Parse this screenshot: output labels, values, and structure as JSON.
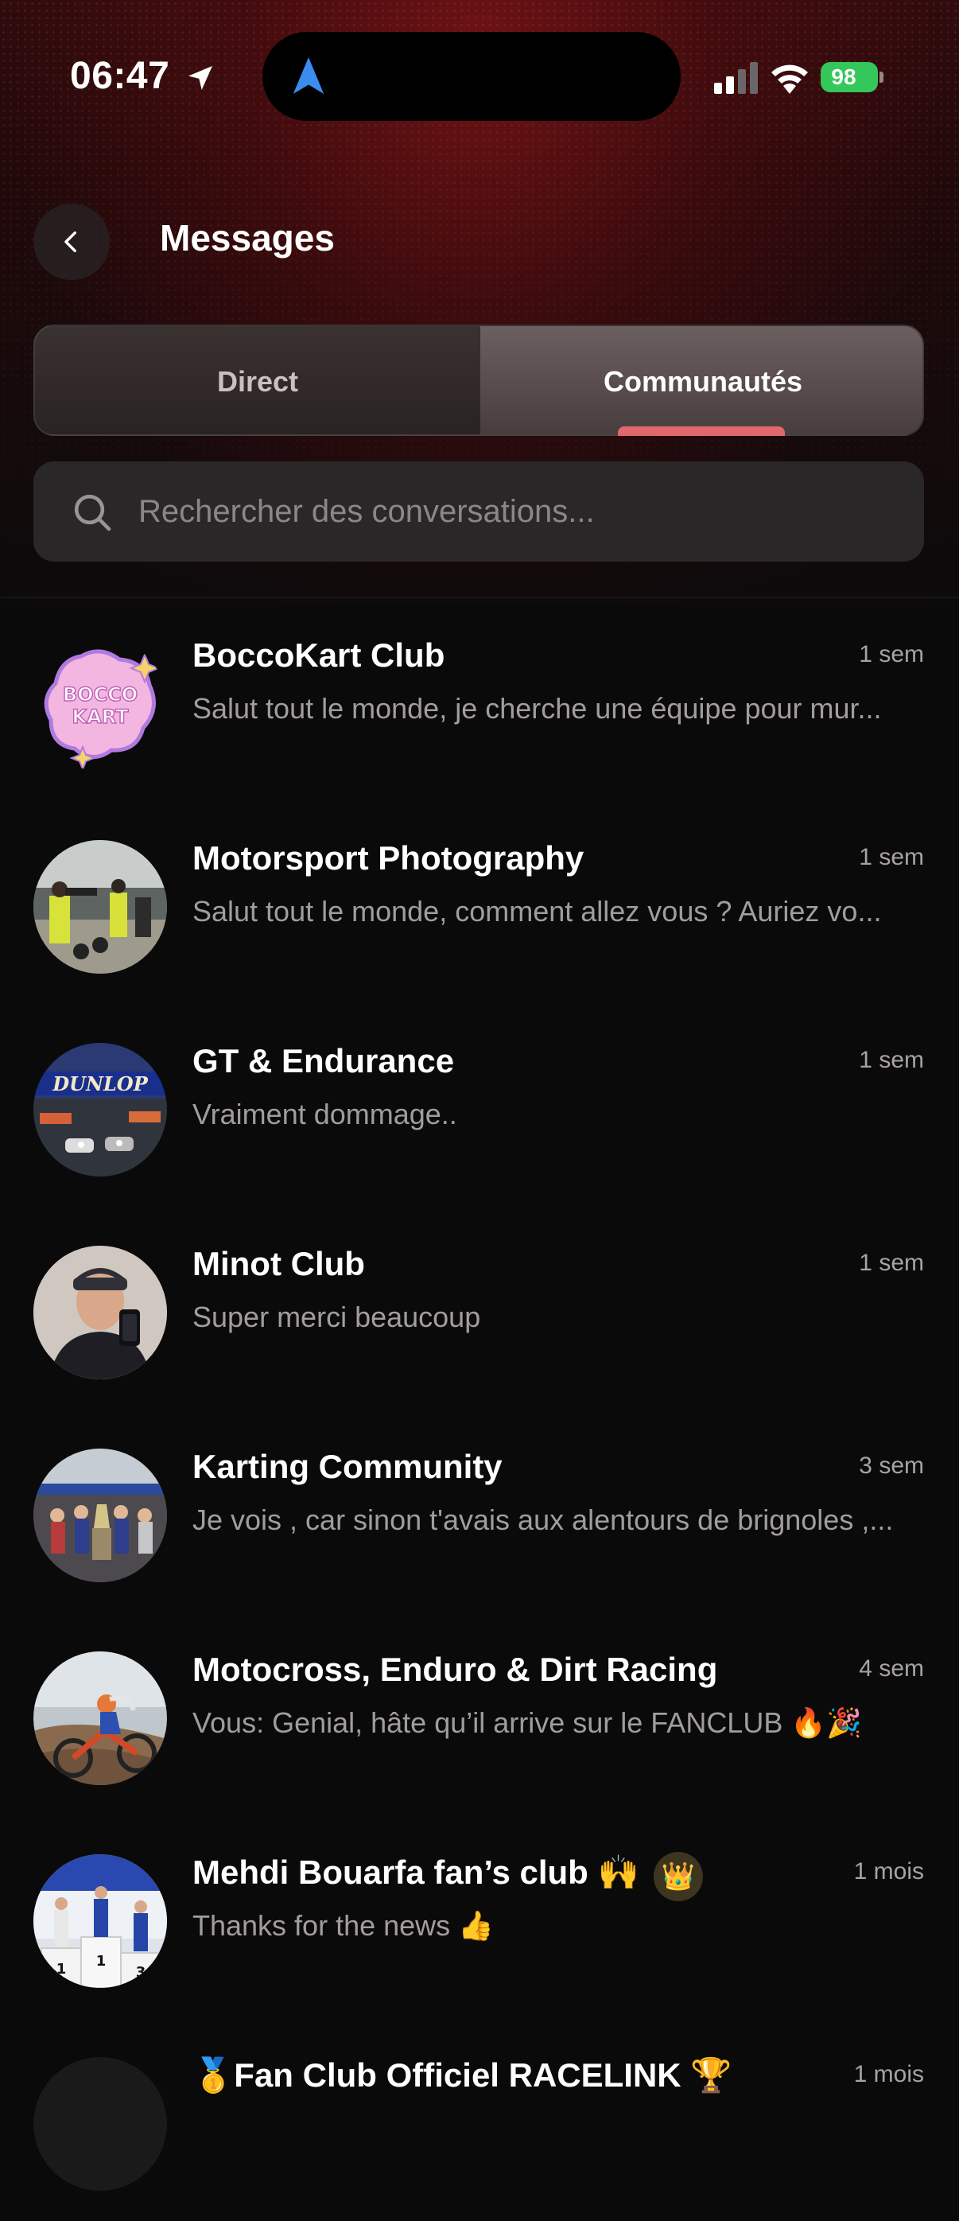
{
  "status_bar": {
    "time": "06:47",
    "battery": "98"
  },
  "header": {
    "title": "Messages"
  },
  "tabs": [
    {
      "label": "Direct",
      "active": false
    },
    {
      "label": "Communautés",
      "active": true
    }
  ],
  "search": {
    "placeholder": "Rechercher des conversations..."
  },
  "conversations": [
    {
      "name": "BoccoKart Club",
      "time": "1 sem",
      "preview": "Salut tout le monde, je cherche une équipe pour mur...",
      "avatar": "bocco-kart-logo"
    },
    {
      "name": "Motorsport Photography",
      "time": "1 sem",
      "preview": "Salut tout le monde, comment allez vous ? Auriez vo...",
      "avatar": "photographers-photo"
    },
    {
      "name": "GT & Endurance",
      "time": "1 sem",
      "preview": "Vraiment dommage..",
      "avatar": "dunlop-bridge-photo"
    },
    {
      "name": "Minot Club",
      "time": "1 sem",
      "preview": "Super merci beaucoup",
      "avatar": "selfie-photo"
    },
    {
      "name": "Karting Community",
      "time": "3 sem",
      "preview": "Je vois , car sinon t'avais aux alentours de brignoles ,...",
      "avatar": "podium-crowd-photo"
    },
    {
      "name": "Motocross, Enduro & Dirt Racing",
      "time": "4 sem",
      "preview": "Vous: Genial, hâte qu’il arrive sur le FANCLUB 🔥🎉",
      "avatar": "motocross-photo"
    },
    {
      "name": "Mehdi Bouarfa fan’s club 🙌",
      "time": "1 mois",
      "preview": "Thanks for the news 👍",
      "avatar": "podium-photo",
      "badge": "👑"
    },
    {
      "name": "🥇Fan Club Officiel RACELINK 🏆",
      "time": "1 mois",
      "preview": "",
      "avatar": "racelink-logo"
    }
  ],
  "colors": {
    "accent": "#e0676b",
    "background": "#0b0a0b",
    "battery": "#34c759"
  }
}
